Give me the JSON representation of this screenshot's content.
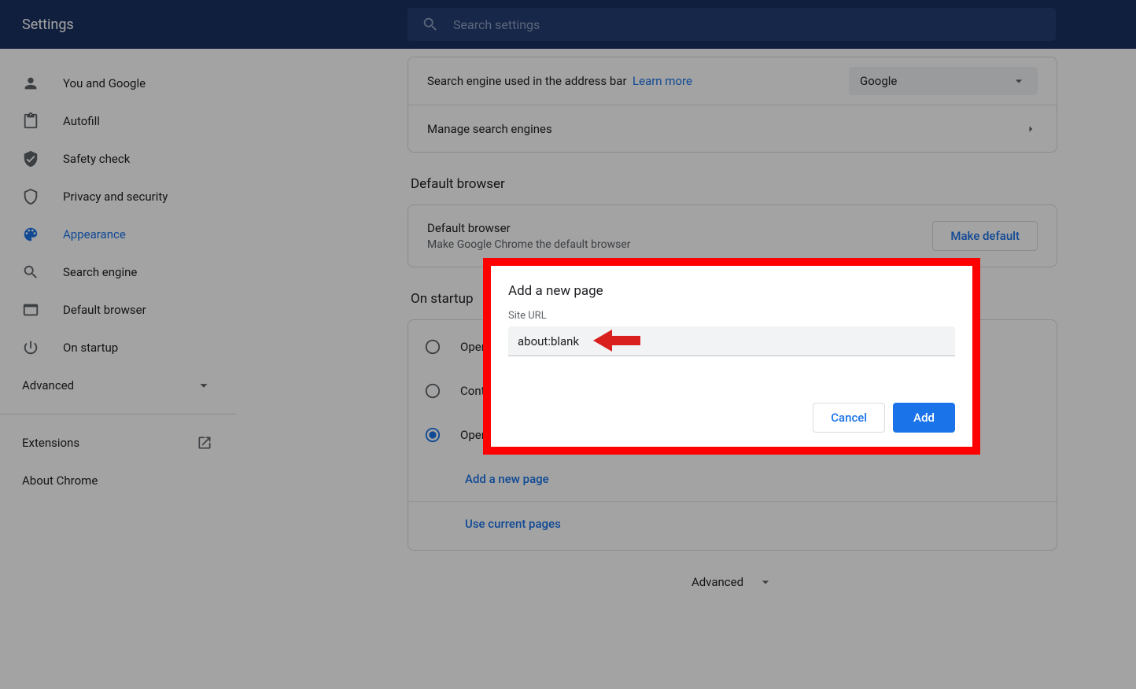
{
  "header": {
    "title": "Settings",
    "search_placeholder": "Search settings"
  },
  "sidebar": {
    "items": [
      {
        "label": "You and Google"
      },
      {
        "label": "Autofill"
      },
      {
        "label": "Safety check"
      },
      {
        "label": "Privacy and security"
      },
      {
        "label": "Appearance"
      },
      {
        "label": "Search engine"
      },
      {
        "label": "Default browser"
      },
      {
        "label": "On startup"
      }
    ],
    "advanced": "Advanced",
    "extensions": "Extensions",
    "about": "About Chrome"
  },
  "search_engine": {
    "label": "Search engine used in the address bar",
    "learn_more": "Learn more",
    "value": "Google",
    "manage": "Manage search engines"
  },
  "default_browser": {
    "section": "Default browser",
    "heading": "Default browser",
    "sub": "Make Google Chrome the default browser",
    "button": "Make default"
  },
  "on_startup": {
    "section": "On startup",
    "options": [
      "Open the New Tab page",
      "Continue where you left off",
      "Open a specific page or set of pages"
    ],
    "add_page": "Add a new page",
    "use_current": "Use current pages"
  },
  "bottom_advanced": "Advanced",
  "dialog": {
    "title": "Add a new page",
    "field_label": "Site URL",
    "url_value": "about:blank",
    "cancel": "Cancel",
    "add": "Add"
  }
}
